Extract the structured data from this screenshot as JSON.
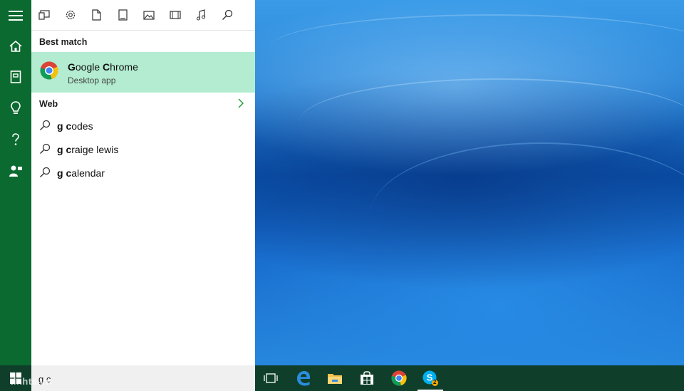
{
  "toolbar": {
    "items": [
      {
        "icon": "apps-icon"
      },
      {
        "icon": "settings-icon"
      },
      {
        "icon": "document-icon"
      },
      {
        "icon": "folders-icon"
      },
      {
        "icon": "photos-icon"
      },
      {
        "icon": "videos-icon"
      },
      {
        "icon": "music-icon"
      },
      {
        "icon": "web-search-icon"
      }
    ]
  },
  "rail": {
    "items": [
      {
        "icon": "hamburger-menu-icon"
      },
      {
        "icon": "home-icon"
      },
      {
        "icon": "notebook-icon"
      },
      {
        "icon": "reminders-icon"
      },
      {
        "icon": "help-icon"
      },
      {
        "icon": "feedback-icon"
      }
    ]
  },
  "best_match": {
    "heading": "Best match",
    "app_name_bold": "G",
    "app_name_rest_1": "oogle ",
    "app_name_bold_2": "C",
    "app_name_rest_2": "hrome",
    "app_type": "Desktop app"
  },
  "web": {
    "heading": "Web",
    "suggestions": [
      {
        "bold": "g c",
        "rest": "odes"
      },
      {
        "bold": "g c",
        "rest": "raige lewis"
      },
      {
        "bold": "g c",
        "rest": "alendar"
      }
    ]
  },
  "search": {
    "query": "g c"
  },
  "watermark": "tinhte.vn",
  "taskbar": {
    "items": [
      {
        "icon": "task-view-icon"
      },
      {
        "icon": "edge-icon"
      },
      {
        "icon": "file-explorer-icon"
      },
      {
        "icon": "store-icon"
      },
      {
        "icon": "chrome-icon"
      },
      {
        "icon": "skype-icon",
        "badge": "2"
      }
    ]
  },
  "colors": {
    "accent": "#0b6a2f",
    "highlight": "#b3ecd0",
    "taskbar": "#0f3f2b"
  }
}
